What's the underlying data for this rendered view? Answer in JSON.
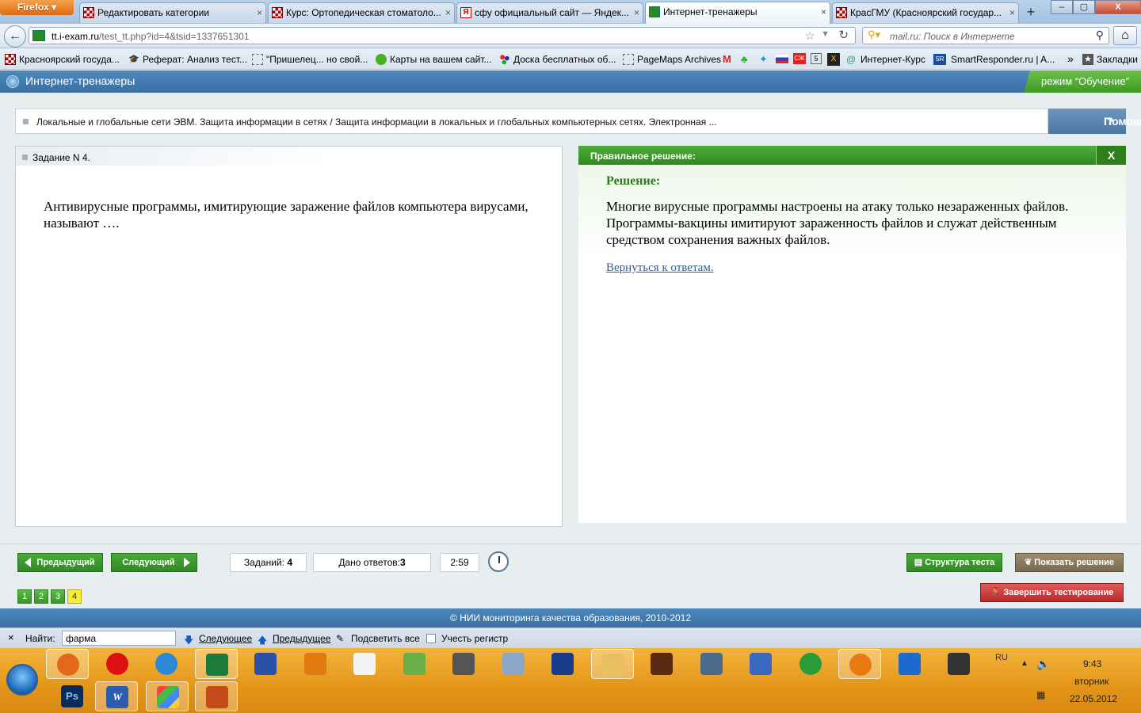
{
  "browser": {
    "menu_button": "Firefox",
    "tabs": [
      {
        "title": "Редактировать категории",
        "favicon": "checker-icon",
        "active": false
      },
      {
        "title": "Курс: Ортопедическая стоматоло...",
        "favicon": "checker-icon",
        "active": false
      },
      {
        "title": "сфу официальный сайт — Яндек...",
        "favicon": "yandex-icon",
        "active": false
      },
      {
        "title": "Интернет-тренажеры",
        "favicon": "envelope-icon",
        "active": true
      },
      {
        "title": "КрасГМУ (Красноярский государ...",
        "favicon": "checker-icon",
        "active": false
      }
    ],
    "new_tab_symbol": "+",
    "window_buttons": {
      "minimize": "–",
      "restore": "▢",
      "close": "X"
    },
    "url_host": "tt.i-exam.ru",
    "url_path": "/test_tt.php?id=4&tsid=1337651301",
    "search_placeholder": "mail.ru: Поиск в Интернете",
    "bookmarks": [
      {
        "label": "Красноярский госуда...",
        "icon": "checker-icon"
      },
      {
        "label": "Реферат: Анализ тест...",
        "icon": "graduation-cap-icon"
      },
      {
        "label": "\"Пришелец... но свой...",
        "icon": "page-icon"
      },
      {
        "label": "Карты на вашем сайт...",
        "icon": "map-icon"
      },
      {
        "label": "Доска бесплатных об...",
        "icon": "dots-icon"
      },
      {
        "label": "PageMaps Archives",
        "icon": "page-icon"
      },
      {
        "label": "Интернет-Курс",
        "icon": "at-icon"
      },
      {
        "label": "SmartResponder.ru | A...",
        "icon": "sr-icon"
      },
      {
        "label": "Закладки",
        "icon": "bookmarks-icon"
      }
    ],
    "bookmarks_overflow": "»"
  },
  "app": {
    "title": "Интернет-тренажеры",
    "mode": "режим “Обучение”",
    "breadcrumb": "Локальные и глобальные сети ЭВМ. Защита информации в сетях / Защита информации в локальных и глобальных компьютерных сетях. Электронная ...",
    "help_label": "Помощь",
    "help_symbol": "?",
    "task_label": "Задание N 4.",
    "question": "Антивирусные программы, имитирующие заражение файлов компьютера вирусами, называют ….",
    "solution_panel_title": "Правильное решение:",
    "solution_close": "X",
    "solution_heading": "Решение:",
    "solution_text": "Многие вирусные программы настроены на атаку только незараженных файлов. Программы-вакцины имитируют зараженность файлов и служат действенным средством сохранения важных файлов.",
    "back_link": "Вернуться к ответам.",
    "prev_button": "Предыдущий",
    "next_button": "Следующий",
    "tasks_label": "Заданий:",
    "tasks_count": "4",
    "answers_label": "Дано ответов:",
    "answers_count": "3",
    "timer": "2:59",
    "structure_button": "Структура теста",
    "show_solution_button": "Показать решение",
    "finish_button": "Завершить тестирование",
    "pages": [
      "1",
      "2",
      "3",
      "4"
    ],
    "current_page": "4",
    "footer": "© НИИ мониторинга качества образования, 2010-2012"
  },
  "findbar": {
    "close": "×",
    "label": "Найти:",
    "value": "фарма",
    "next": "Следующее",
    "prev": "Предыдущее",
    "highlight": "Подсветить все",
    "match_case": "Учесть регистр"
  },
  "taskbar": {
    "lang": "RU",
    "time": "9:43",
    "day": "вторник",
    "date": "22.05.2012",
    "apps_row1": [
      "firefox-icon",
      "opera-icon",
      "ie-icon",
      "excel-icon",
      "db-icon",
      "media-icon",
      "blank-doc-icon",
      "network-icon",
      "signature-icon",
      "calculator-icon",
      "floppy-icon",
      "explorer-icon",
      "bridge-icon",
      "disk-icon",
      "shield-globe-icon",
      "globe-icon",
      "mail-at-icon",
      "grid-icon",
      "hat-icon"
    ],
    "apps_row2_labels": [
      "Ps",
      "W"
    ]
  },
  "colors": {
    "app_blue": "#3a70a3",
    "accent_green": "#3d9a24",
    "finish_red": "#b82a2a",
    "link_blue": "#2b5f9a",
    "taskbar_orange": "#e39618"
  }
}
